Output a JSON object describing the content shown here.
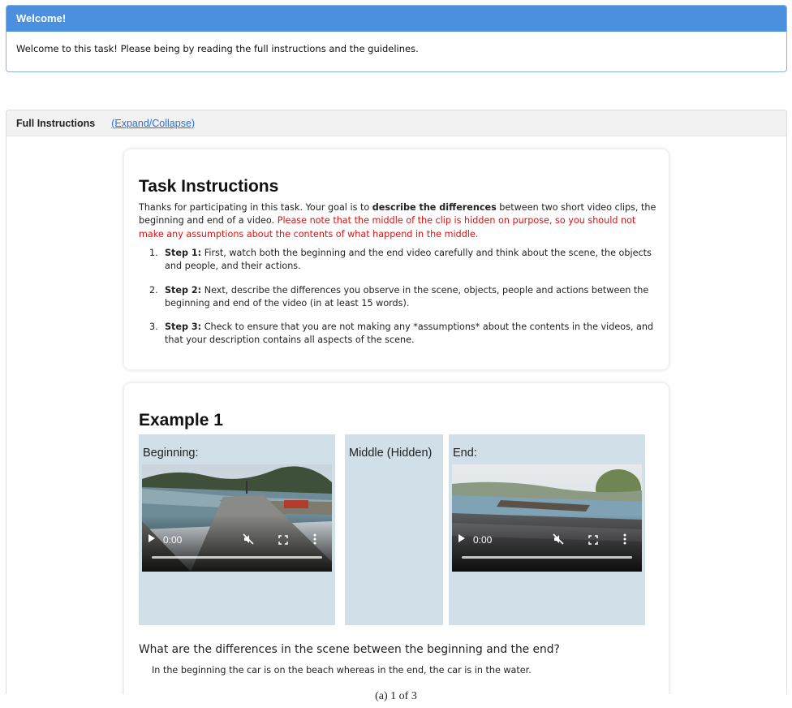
{
  "welcome": {
    "title": "Welcome!",
    "text": "Welcome to this task! Please being by reading the full instructions and the guidelines."
  },
  "full_instructions": {
    "title": "Full Instructions",
    "toggle_link": "(Expand/Collapse)"
  },
  "task": {
    "heading": "Task Instructions",
    "intro_1": "Thanks for participating in this task. Your goal is to ",
    "intro_bold": "describe the differences",
    "intro_2": " between two short video clips, the beginning and end of a video. ",
    "intro_red": "Please note that the middle of the clip is hidden on purpose, so you should not make any assumptions about the contents of what happend in the middle.",
    "steps": [
      {
        "num": "1.",
        "label": "Step 1:",
        "text": " First, watch both the beginning and the end video carefully and think about the scene, the objects and people, and their actions."
      },
      {
        "num": "2.",
        "label": "Step 2:",
        "text": " Next, describe the differences you observe in the scene, objects, people and actions between the beginning and end of the video (in at least 15 words)."
      },
      {
        "num": "3.",
        "label": "Step 3:",
        "text": " Check to ensure that you are not making any *assumptions* about the contents in the videos, and that your description contains all aspects of the scene."
      }
    ]
  },
  "example": {
    "heading": "Example 1",
    "beginning_label": "Beginning:",
    "middle_label": "Middle (Hidden)",
    "end_label": "End:",
    "video_begin": {
      "time": "0:00"
    },
    "video_end": {
      "time": "0:00"
    },
    "question": "What are the differences in the scene between the beginning and the end?",
    "answer": "In the beginning the car is on the beach whereas in the end, the car is in the water."
  },
  "caption": "(a) 1 of 3",
  "colors": {
    "header_blue": "#4a90de",
    "column_bg": "#d1dfe8",
    "warning_red": "#e01010",
    "link_blue": "#2a6fdb"
  }
}
